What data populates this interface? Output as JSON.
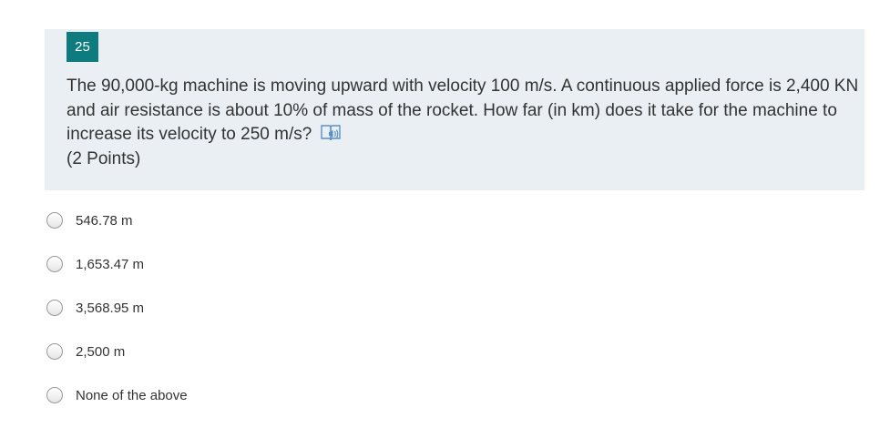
{
  "question": {
    "number": "25",
    "text": "The 90,000-kg machine is moving upward with velocity 100 m/s. A continuous applied force is 2,400 KN and air resistance is about 10% of mass of the rocket. How far (in km) does it take for the machine to increase its velocity to 250 m/s?",
    "points": "(2 Points)",
    "read_aloud_icon": "immersive-reader-icon",
    "accent_color": "#0e7c7e",
    "card_background": "#e9eff2"
  },
  "options": [
    {
      "label": "546.78 m",
      "selected": false
    },
    {
      "label": "1,653.47 m",
      "selected": false
    },
    {
      "label": "3,568.95 m",
      "selected": false
    },
    {
      "label": "2,500 m",
      "selected": false
    },
    {
      "label": "None of the above",
      "selected": false
    }
  ]
}
